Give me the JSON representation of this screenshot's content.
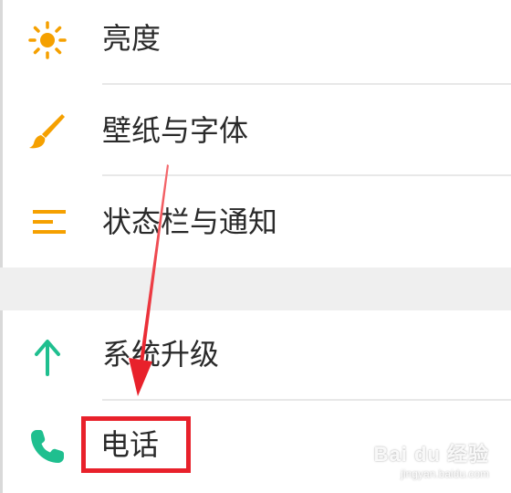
{
  "settings_list": {
    "items": [
      {
        "label": "亮度",
        "icon": "brightness-icon"
      },
      {
        "label": "壁纸与字体",
        "icon": "brush-icon"
      },
      {
        "label": "状态栏与通知",
        "icon": "status-bar-icon"
      },
      {
        "label": "系统升级",
        "icon": "arrow-up-icon"
      },
      {
        "label": "电话",
        "icon": "phone-icon"
      }
    ]
  },
  "colors": {
    "accent_orange": "#f5a000",
    "accent_green": "#1fbf8f",
    "annotation_red": "#e8212b",
    "section_gap": "#efefef"
  },
  "watermark": {
    "main": "Bai du 经验",
    "sub": "jingyan.baidu.com"
  }
}
